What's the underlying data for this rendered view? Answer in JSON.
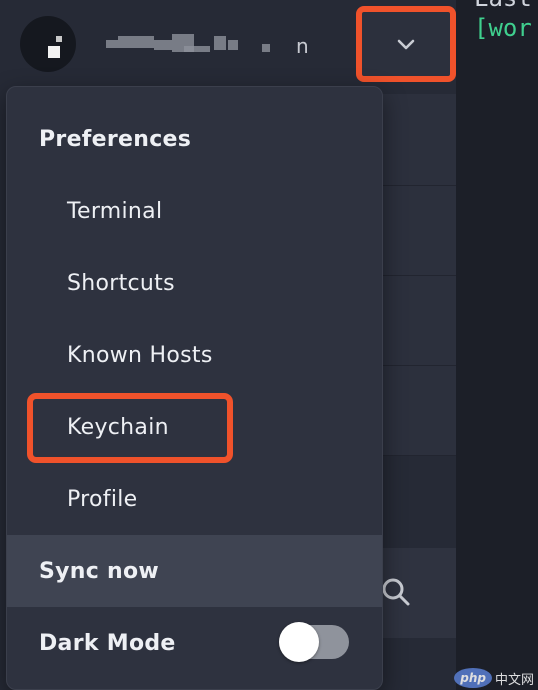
{
  "terminal": {
    "line1": "Last",
    "line2": "[wor"
  },
  "account": {
    "name_suffix": "n"
  },
  "menu": {
    "preferences": "Preferences",
    "items": [
      "Terminal",
      "Shortcuts",
      "Known Hosts",
      "Keychain",
      "Profile"
    ],
    "sync_now": "Sync now",
    "dark_mode": "Dark Mode",
    "dark_mode_on": false
  },
  "watermark": {
    "badge": "php",
    "text": "中文网"
  },
  "colors": {
    "highlight_outline": "#f0522b",
    "terminal_text": "#3fcf8e"
  },
  "icons": {
    "dropdown": "chevron-down-icon",
    "search": "search-icon"
  }
}
